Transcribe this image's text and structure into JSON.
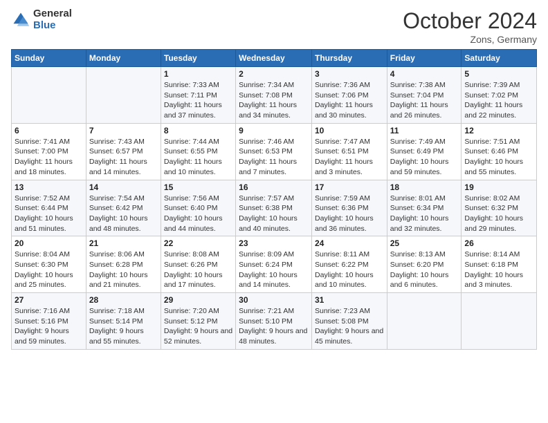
{
  "logo": {
    "general": "General",
    "blue": "Blue"
  },
  "header": {
    "month": "October 2024",
    "location": "Zons, Germany"
  },
  "weekdays": [
    "Sunday",
    "Monday",
    "Tuesday",
    "Wednesday",
    "Thursday",
    "Friday",
    "Saturday"
  ],
  "weeks": [
    [
      {
        "day": "",
        "info": ""
      },
      {
        "day": "",
        "info": ""
      },
      {
        "day": "1",
        "info": "Sunrise: 7:33 AM\nSunset: 7:11 PM\nDaylight: 11 hours and 37 minutes."
      },
      {
        "day": "2",
        "info": "Sunrise: 7:34 AM\nSunset: 7:08 PM\nDaylight: 11 hours and 34 minutes."
      },
      {
        "day": "3",
        "info": "Sunrise: 7:36 AM\nSunset: 7:06 PM\nDaylight: 11 hours and 30 minutes."
      },
      {
        "day": "4",
        "info": "Sunrise: 7:38 AM\nSunset: 7:04 PM\nDaylight: 11 hours and 26 minutes."
      },
      {
        "day": "5",
        "info": "Sunrise: 7:39 AM\nSunset: 7:02 PM\nDaylight: 11 hours and 22 minutes."
      }
    ],
    [
      {
        "day": "6",
        "info": "Sunrise: 7:41 AM\nSunset: 7:00 PM\nDaylight: 11 hours and 18 minutes."
      },
      {
        "day": "7",
        "info": "Sunrise: 7:43 AM\nSunset: 6:57 PM\nDaylight: 11 hours and 14 minutes."
      },
      {
        "day": "8",
        "info": "Sunrise: 7:44 AM\nSunset: 6:55 PM\nDaylight: 11 hours and 10 minutes."
      },
      {
        "day": "9",
        "info": "Sunrise: 7:46 AM\nSunset: 6:53 PM\nDaylight: 11 hours and 7 minutes."
      },
      {
        "day": "10",
        "info": "Sunrise: 7:47 AM\nSunset: 6:51 PM\nDaylight: 11 hours and 3 minutes."
      },
      {
        "day": "11",
        "info": "Sunrise: 7:49 AM\nSunset: 6:49 PM\nDaylight: 10 hours and 59 minutes."
      },
      {
        "day": "12",
        "info": "Sunrise: 7:51 AM\nSunset: 6:46 PM\nDaylight: 10 hours and 55 minutes."
      }
    ],
    [
      {
        "day": "13",
        "info": "Sunrise: 7:52 AM\nSunset: 6:44 PM\nDaylight: 10 hours and 51 minutes."
      },
      {
        "day": "14",
        "info": "Sunrise: 7:54 AM\nSunset: 6:42 PM\nDaylight: 10 hours and 48 minutes."
      },
      {
        "day": "15",
        "info": "Sunrise: 7:56 AM\nSunset: 6:40 PM\nDaylight: 10 hours and 44 minutes."
      },
      {
        "day": "16",
        "info": "Sunrise: 7:57 AM\nSunset: 6:38 PM\nDaylight: 10 hours and 40 minutes."
      },
      {
        "day": "17",
        "info": "Sunrise: 7:59 AM\nSunset: 6:36 PM\nDaylight: 10 hours and 36 minutes."
      },
      {
        "day": "18",
        "info": "Sunrise: 8:01 AM\nSunset: 6:34 PM\nDaylight: 10 hours and 32 minutes."
      },
      {
        "day": "19",
        "info": "Sunrise: 8:02 AM\nSunset: 6:32 PM\nDaylight: 10 hours and 29 minutes."
      }
    ],
    [
      {
        "day": "20",
        "info": "Sunrise: 8:04 AM\nSunset: 6:30 PM\nDaylight: 10 hours and 25 minutes."
      },
      {
        "day": "21",
        "info": "Sunrise: 8:06 AM\nSunset: 6:28 PM\nDaylight: 10 hours and 21 minutes."
      },
      {
        "day": "22",
        "info": "Sunrise: 8:08 AM\nSunset: 6:26 PM\nDaylight: 10 hours and 17 minutes."
      },
      {
        "day": "23",
        "info": "Sunrise: 8:09 AM\nSunset: 6:24 PM\nDaylight: 10 hours and 14 minutes."
      },
      {
        "day": "24",
        "info": "Sunrise: 8:11 AM\nSunset: 6:22 PM\nDaylight: 10 hours and 10 minutes."
      },
      {
        "day": "25",
        "info": "Sunrise: 8:13 AM\nSunset: 6:20 PM\nDaylight: 10 hours and 6 minutes."
      },
      {
        "day": "26",
        "info": "Sunrise: 8:14 AM\nSunset: 6:18 PM\nDaylight: 10 hours and 3 minutes."
      }
    ],
    [
      {
        "day": "27",
        "info": "Sunrise: 7:16 AM\nSunset: 5:16 PM\nDaylight: 9 hours and 59 minutes."
      },
      {
        "day": "28",
        "info": "Sunrise: 7:18 AM\nSunset: 5:14 PM\nDaylight: 9 hours and 55 minutes."
      },
      {
        "day": "29",
        "info": "Sunrise: 7:20 AM\nSunset: 5:12 PM\nDaylight: 9 hours and 52 minutes."
      },
      {
        "day": "30",
        "info": "Sunrise: 7:21 AM\nSunset: 5:10 PM\nDaylight: 9 hours and 48 minutes."
      },
      {
        "day": "31",
        "info": "Sunrise: 7:23 AM\nSunset: 5:08 PM\nDaylight: 9 hours and 45 minutes."
      },
      {
        "day": "",
        "info": ""
      },
      {
        "day": "",
        "info": ""
      }
    ]
  ]
}
